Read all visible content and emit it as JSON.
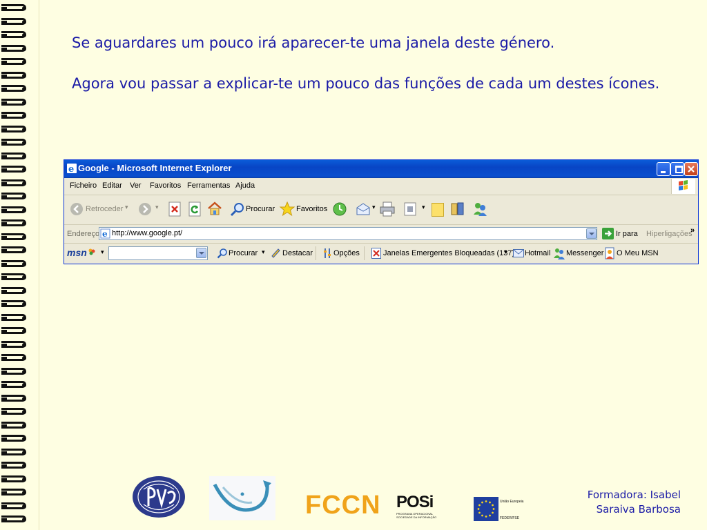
{
  "slide": {
    "line1": "Se aguardares um pouco irá aparecer-te uma janela deste género.",
    "line2": "Agora vou passar a explicar-te um pouco das funções de cada um destes ícones."
  },
  "browser": {
    "title": "Google - Microsoft Internet Explorer",
    "menu": [
      "Ficheiro",
      "Editar",
      "Ver",
      "Favoritos",
      "Ferramentas",
      "Ajuda"
    ],
    "toolbar": {
      "back": "Retroceder",
      "search": "Procurar",
      "favorites": "Favoritos"
    },
    "address": {
      "label": "Endereço",
      "url": "http://www.google.pt/",
      "go": "Ir para",
      "links": "Hiperligações",
      "chevron": "»"
    },
    "msn": {
      "logo": "msn",
      "search": "Procurar",
      "highlight": "Destacar",
      "options": "Opções",
      "popups": "Janelas Emergentes Bloqueadas (137)",
      "hotmail": "Hotmail",
      "messenger": "Messenger",
      "mymsn": "O Meu MSN"
    }
  },
  "footer": {
    "fccn": "FCCN",
    "posi": "POSi",
    "posi_sub": "PROGRAMA OPERACIONAL SOCIEDADE DA INFORMAÇÃO",
    "eu_top": "União Europeia",
    "eu_bottom": "FEDER/FSE",
    "credit_line1": "Formadora: Isabel",
    "credit_line2": "Saraiva Barbosa"
  },
  "colors": {
    "background": "#fefee2",
    "text": "#1a1aa6",
    "titlebar": "#0a4fcf"
  }
}
